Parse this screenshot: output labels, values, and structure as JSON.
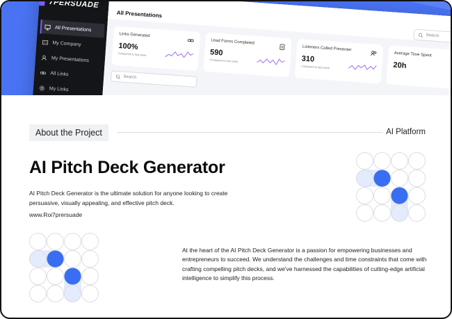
{
  "colors": {
    "accent": "#3a6ef2",
    "hero_bg": "#4a73f3",
    "sidebar_bg": "#141518",
    "brand_purple": "#7c5cf5",
    "pale_blue": "#e3ebfc"
  },
  "dashboard": {
    "logo": "7PERSUADE",
    "title": "All Presentations",
    "nav": [
      {
        "label": "All Presentations",
        "icon": "presentation-icon"
      },
      {
        "label": "My Company",
        "icon": "company-icon"
      },
      {
        "label": "My Presentations",
        "icon": "user-icon"
      },
      {
        "label": "All Links",
        "icon": "link-icon"
      },
      {
        "label": "My Links",
        "icon": "gear-icon"
      }
    ],
    "stats": [
      {
        "label": "Links Generated",
        "value": "100%",
        "sub": "Compared to last week",
        "icon": "link-icon"
      },
      {
        "label": "Lead Forms Completed",
        "value": "590",
        "sub": "Compared to last week",
        "icon": "clipboard-icon"
      },
      {
        "label": "Listeners Called Presenter",
        "value": "310",
        "sub": "Compared to last week",
        "icon": "users-icon"
      },
      {
        "label": "Average Time Spent",
        "value": "20h",
        "sub": "",
        "icon": "clock-icon"
      }
    ],
    "search_placeholder": "Search",
    "search_placeholder_top": "Search"
  },
  "about": {
    "tag": "About the Project",
    "category": "AI Platform"
  },
  "project": {
    "title": "AI Pitch Deck Generator",
    "description": "AI Pitch Deck Generator is the ultimate solution for anyone looking to create persuasive, visually appealing, and effective pitch deck.",
    "url": "www.Roi7prersuade",
    "body": "At the heart of the AI Pitch Deck Generator is a passion for empowering businesses and entrepreneurs to succeed. We understand the challenges and time constraints that come with crafting compelling pitch decks, and we've harnessed the capabilities of cutting-edge artificial intelligence to simplify this process."
  }
}
